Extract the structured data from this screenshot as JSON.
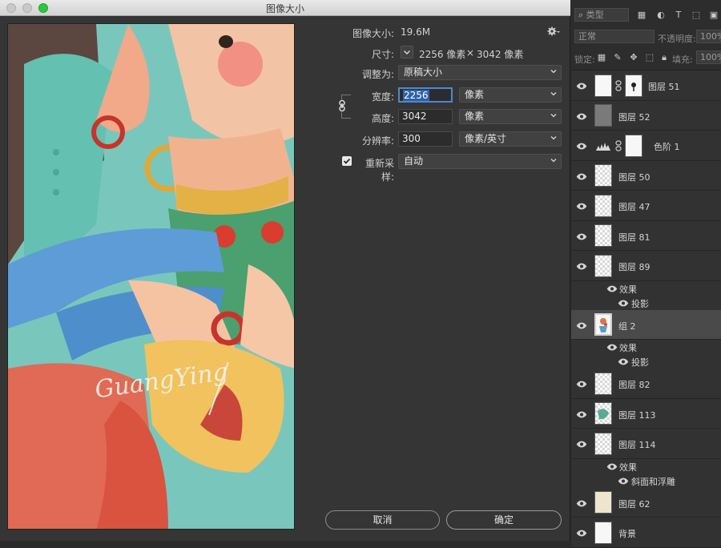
{
  "window": {
    "title": "图像大小"
  },
  "image_size": {
    "label": "图像大小:",
    "value": "19.6M"
  },
  "dimensions": {
    "label": "尺寸:",
    "width": "2256 像素",
    "times": "×",
    "height": "3042 像素"
  },
  "fit_to": {
    "label": "调整为:",
    "value": "原稿大小"
  },
  "width": {
    "label": "宽度:",
    "value": "2256",
    "unit": "像素"
  },
  "height": {
    "label": "高度:",
    "value": "3042",
    "unit": "像素"
  },
  "resolution": {
    "label": "分辨率:",
    "value": "300",
    "unit": "像素/英寸"
  },
  "resample": {
    "label": "重新采样:",
    "checked": true,
    "value": "自动"
  },
  "buttons": {
    "cancel": "取消",
    "ok": "确定"
  },
  "preview": {
    "watermark": "GuangYing"
  },
  "panel": {
    "filter_placeholder": "类型",
    "blend_mode": "正常",
    "opacity_label": "不透明度:",
    "opacity_value": "100%",
    "lock_label": "锁定:",
    "fill_label": "填充:",
    "fill_value": "100%"
  },
  "layers": [
    {
      "name": "图层 51",
      "thumb": "white",
      "mask": true,
      "selected": false
    },
    {
      "name": "图层 52",
      "thumb": "gray",
      "mask": false,
      "selected": false
    },
    {
      "name": "色阶 1",
      "thumb": "levels",
      "mask": true,
      "selected": false
    },
    {
      "name": "图层 50",
      "thumb": "checker",
      "mask": false,
      "selected": false
    },
    {
      "name": "图层 47",
      "thumb": "checker",
      "mask": false,
      "selected": false
    },
    {
      "name": "图层 81",
      "thumb": "checker",
      "mask": false,
      "selected": false
    },
    {
      "name": "图层 89",
      "thumb": "checker",
      "mask": false,
      "selected": false,
      "effects": [
        "效果",
        "投影"
      ]
    },
    {
      "name": "组 2",
      "thumb": "group",
      "mask": false,
      "selected": true,
      "effects": [
        "效果",
        "投影"
      ]
    },
    {
      "name": "图层 82",
      "thumb": "checker",
      "mask": false,
      "selected": false
    },
    {
      "name": "图层 113",
      "thumb": "checker",
      "mask": false,
      "selected": false
    },
    {
      "name": "图层 114",
      "thumb": "checker",
      "mask": false,
      "selected": false,
      "effects": [
        "效果",
        "斜面和浮雕"
      ]
    },
    {
      "name": "图层 62",
      "thumb": "cream",
      "mask": false,
      "selected": false
    },
    {
      "name": "背景",
      "thumb": "white",
      "mask": false,
      "selected": false
    }
  ]
}
